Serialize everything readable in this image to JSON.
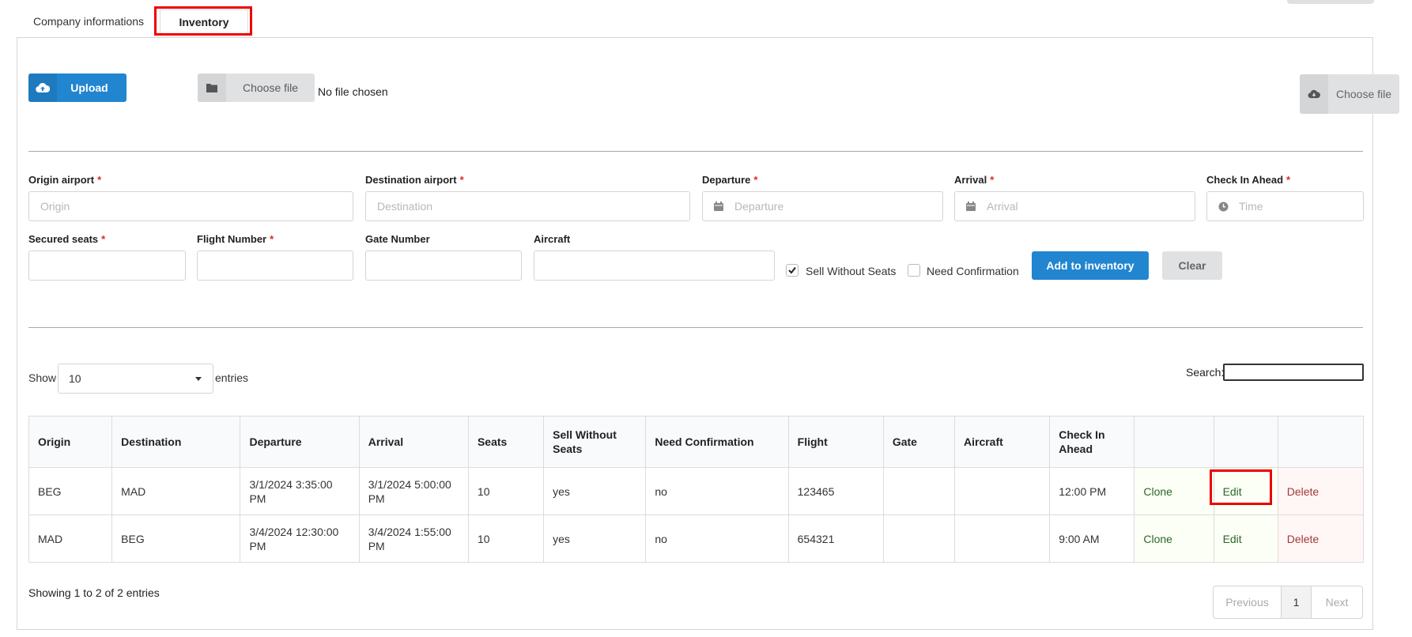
{
  "tabs": {
    "company": "Company informations",
    "inventory": "Inventory"
  },
  "upload": {
    "button_label": "Upload",
    "choose_label": "Choose file",
    "no_file": "No file chosen",
    "choose2_label": "Choose file"
  },
  "form": {
    "origin": {
      "label": "Origin airport",
      "placeholder": "Origin",
      "required": "*"
    },
    "destination": {
      "label": "Destination airport",
      "placeholder": "Destination",
      "required": "*"
    },
    "departure": {
      "label": "Departure",
      "placeholder": "Departure",
      "required": "*"
    },
    "arrival": {
      "label": "Arrival",
      "placeholder": "Arrival",
      "required": "*"
    },
    "checkin": {
      "label": "Check In Ahead",
      "placeholder": "Time",
      "required": "*"
    },
    "seats": {
      "label": "Secured seats",
      "value": "",
      "required": "*"
    },
    "flight": {
      "label": "Flight Number",
      "value": "",
      "required": "*"
    },
    "gate": {
      "label": "Gate Number",
      "value": ""
    },
    "aircraft": {
      "label": "Aircraft",
      "value": ""
    },
    "sell_without_seats": {
      "label": "Sell Without Seats",
      "checked": true
    },
    "need_confirmation": {
      "label": "Need Confirmation",
      "checked": false
    },
    "add_label": "Add to inventory",
    "clear_label": "Clear"
  },
  "list": {
    "show": "Show",
    "entries_value": "10",
    "entries": "entries",
    "search_label": "Search:",
    "columns": [
      "Origin",
      "Destination",
      "Departure",
      "Arrival",
      "Seats",
      "Sell Without Seats",
      "Need Confirmation",
      "Flight",
      "Gate",
      "Aircraft",
      "Check In Ahead",
      "",
      "",
      ""
    ],
    "rows": [
      {
        "origin": "BEG",
        "destination": "MAD",
        "departure": "3/1/2024 3:35:00 PM",
        "arrival": "3/1/2024 5:00:00 PM",
        "seats": "10",
        "sell": "yes",
        "confirm": "no",
        "flight": "123465",
        "gate": "",
        "aircraft": "",
        "checkin": "12:00 PM",
        "clone": "Clone",
        "edit": "Edit",
        "delete": "Delete"
      },
      {
        "origin": "MAD",
        "destination": "BEG",
        "departure": "3/4/2024 12:30:00 PM",
        "arrival": "3/4/2024 1:55:00 PM",
        "seats": "10",
        "sell": "yes",
        "confirm": "no",
        "flight": "654321",
        "gate": "",
        "aircraft": "",
        "checkin": "9:00 AM",
        "clone": "Clone",
        "edit": "Edit",
        "delete": "Delete"
      }
    ],
    "showing": "Showing 1 to 2 of 2 entries",
    "pagination": {
      "previous": "Previous",
      "page": "1",
      "next": "Next"
    }
  },
  "colors": {
    "primary": "#2185d0",
    "highlight": "#ee0000",
    "required": "#db2828",
    "positive": "#2c662d",
    "negative": "#9f3a38"
  }
}
